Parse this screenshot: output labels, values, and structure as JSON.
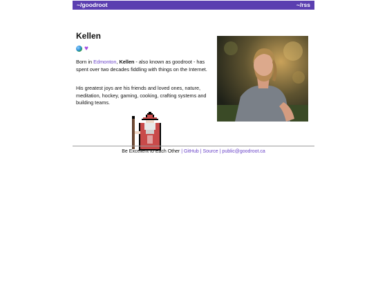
{
  "nav": {
    "home_label": "~/goodroot",
    "rss_label": "~/rss"
  },
  "profile": {
    "name": "Kellen",
    "emojis": [
      "globe-icon",
      "purple-heart-icon"
    ],
    "bio1": {
      "prefix": "Born in ",
      "city": "Edmonton",
      "comma": ", ",
      "name_bold": "Kellen",
      "suffix": " - also known as goodroot - has spent over two decades fiddling with things on the Internet."
    },
    "bio2": "His greatest joys are his friends and loved ones, nature, meditation, hockey, gaming, cooking, crafting systems and building teams."
  },
  "footer": {
    "motto": "Be Excellent to Each Other",
    "separator": "|",
    "github_label": "GitHub",
    "source_label": "Source",
    "email_label": "public@goodroot.ca"
  },
  "colors": {
    "accent": "#5b3fb0",
    "link": "#6a44c8"
  }
}
